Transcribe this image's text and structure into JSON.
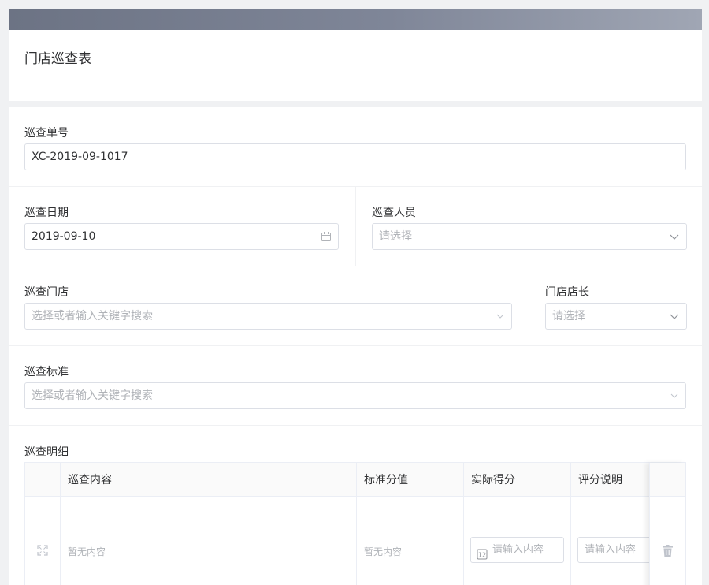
{
  "page": {
    "title": "门店巡查表"
  },
  "form": {
    "inspection_no": {
      "label": "巡查单号",
      "value": "XC-2019-09-1017"
    },
    "inspection_date": {
      "label": "巡查日期",
      "value": "2019-09-10"
    },
    "inspector": {
      "label": "巡查人员",
      "placeholder": "请选择"
    },
    "store": {
      "label": "巡查门店",
      "placeholder": "选择或者输入关键字搜索"
    },
    "manager": {
      "label": "门店店长",
      "placeholder": "请选择"
    },
    "standard": {
      "label": "巡查标准",
      "placeholder": "选择或者输入关键字搜索"
    }
  },
  "details": {
    "label": "巡查明细",
    "columns": [
      "巡查内容",
      "标准分值",
      "实际得分",
      "评分说明"
    ],
    "row": {
      "content": "暂无内容",
      "standard_score": "暂无内容",
      "actual_score_placeholder": "请输入内容",
      "remark_placeholder": "请输入内容"
    }
  },
  "colors": {
    "accent_bar": "#6c7384",
    "border": "#dcdfe6",
    "placeholder": "#b0b3b8"
  }
}
